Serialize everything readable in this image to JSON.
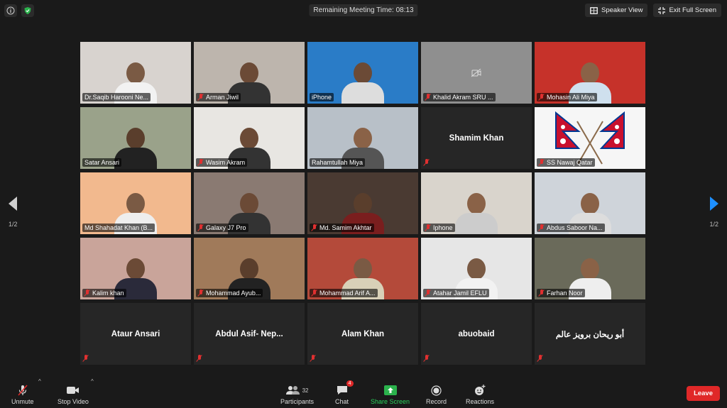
{
  "top": {
    "info_icon": "info-icon",
    "shield_icon": "shield-icon",
    "timer_text": "Remaining Meeting Time: 08:13",
    "speaker_view": "Speaker View",
    "exit_full_screen": "Exit Full Screen"
  },
  "pagination": {
    "left": "1/2",
    "right": "1/2"
  },
  "participants": [
    {
      "name": "Dr.Saqib Harooni Ne...",
      "muted": false,
      "video": true,
      "bg": "#d8d3cf",
      "skin": "#7a5a44",
      "shirt": "#f2f2f2"
    },
    {
      "name": "Arman Jiwil",
      "muted": true,
      "video": true,
      "bg": "#bdb5ad",
      "skin": "#6b4a36",
      "shirt": "#333"
    },
    {
      "name": "iPhone",
      "muted": false,
      "video": true,
      "bg": "#2a7cc7",
      "skin": "#6b4a36",
      "shirt": "#ddd"
    },
    {
      "name": "Khalid Akram SRU ...",
      "muted": true,
      "video": false,
      "bg": "#8f8f8f",
      "skin": "",
      "shirt": ""
    },
    {
      "name": "Mohasin Ali Miya",
      "muted": true,
      "video": true,
      "bg": "#c6322a",
      "skin": "#8a6247",
      "shirt": "#cfe0ee"
    },
    {
      "name": "Satar Ansari",
      "muted": false,
      "video": true,
      "bg": "#9aa28a",
      "skin": "#5a3e2c",
      "shirt": "#222"
    },
    {
      "name": "Wasim Akram",
      "muted": true,
      "video": true,
      "bg": "#e8e6e2",
      "skin": "#6b4a36",
      "shirt": "#333"
    },
    {
      "name": "Rahamtullah Miya",
      "muted": false,
      "video": true,
      "bg": "#b8c0c8",
      "skin": "#8a6247",
      "shirt": "#555",
      "active": true
    },
    {
      "name": "Shamim Khan",
      "muted": true,
      "video": false,
      "bg": "#262626",
      "skin": "",
      "shirt": "",
      "center": true
    },
    {
      "name": "SS Nawaj Qatar",
      "muted": true,
      "video": true,
      "bg": "#f6f6f6",
      "skin": "",
      "shirt": "",
      "flag": true
    },
    {
      "name": "Md Shahadat Khan (B...",
      "muted": false,
      "video": true,
      "bg": "#f2b98e",
      "skin": "#7a5a44",
      "shirt": "#eee"
    },
    {
      "name": "Galaxy J7 Pro",
      "muted": true,
      "video": true,
      "bg": "#8a7a72",
      "skin": "#6b4a36",
      "shirt": "#333"
    },
    {
      "name": "Md. Samim Akhtar",
      "muted": true,
      "video": true,
      "bg": "#4a3a32",
      "skin": "#5a3e2c",
      "shirt": "#7a1e1e"
    },
    {
      "name": "Iphone",
      "muted": true,
      "video": true,
      "bg": "#d9d4cc",
      "skin": "#8a6247",
      "shirt": "#ccc"
    },
    {
      "name": "Abdus Saboor Na...",
      "muted": true,
      "video": true,
      "bg": "#cfd4da",
      "skin": "#8a6247",
      "shirt": "#ddd"
    },
    {
      "name": "Kalim khan",
      "muted": true,
      "video": true,
      "bg": "#c9a49a",
      "skin": "#6b4a36",
      "shirt": "#2a2a3a"
    },
    {
      "name": "Mohammad  Ayub...",
      "muted": true,
      "video": true,
      "bg": "#a07a5a",
      "skin": "#5a3e2c",
      "shirt": "#222"
    },
    {
      "name": "Mohammad Arif A...",
      "muted": true,
      "video": true,
      "bg": "#b44a3a",
      "skin": "#7a5a44",
      "shirt": "#d8d0b8"
    },
    {
      "name": "Atahar Jamil EFLU",
      "muted": true,
      "video": true,
      "bg": "#e6e6e6",
      "skin": "#7a5a44",
      "shirt": "#f2f2f2"
    },
    {
      "name": "Farhan Noor",
      "muted": true,
      "video": true,
      "bg": "#6a6a5a",
      "skin": "#8a6247",
      "shirt": "#eee"
    },
    {
      "name": "Ataur Ansari",
      "muted": true,
      "video": false,
      "bg": "#262626",
      "skin": "",
      "shirt": "",
      "center": true
    },
    {
      "name": "Abdul Asif- Nep...",
      "muted": true,
      "video": false,
      "bg": "#262626",
      "skin": "",
      "shirt": "",
      "center": true
    },
    {
      "name": "Alam Khan",
      "muted": true,
      "video": false,
      "bg": "#262626",
      "skin": "",
      "shirt": "",
      "center": true
    },
    {
      "name": "abuobaid",
      "muted": true,
      "video": false,
      "bg": "#262626",
      "skin": "",
      "shirt": "",
      "center": true
    },
    {
      "name": "أبو ريحان برويز عالم",
      "muted": true,
      "video": false,
      "bg": "#262626",
      "skin": "",
      "shirt": "",
      "center": true
    }
  ],
  "toolbar": {
    "unmute": "Unmute",
    "stop_video": "Stop Video",
    "participants": "Participants",
    "participants_count": "32",
    "chat": "Chat",
    "chat_badge": "4",
    "share_screen": "Share Screen",
    "record": "Record",
    "reactions": "Reactions",
    "leave": "Leave"
  }
}
